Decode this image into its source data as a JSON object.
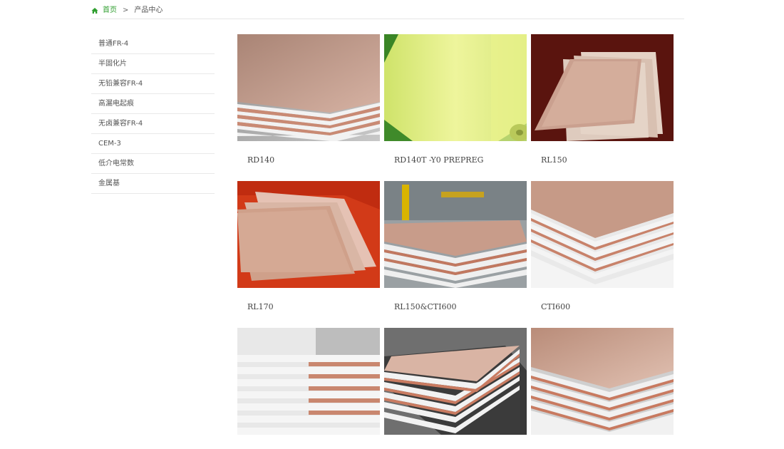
{
  "breadcrumb": {
    "home": "首页",
    "separator": ">",
    "current": "产品中心"
  },
  "sidebar": {
    "items": [
      {
        "label": "普通FR-4"
      },
      {
        "label": "半固化片"
      },
      {
        "label": "无铅兼容FR-4"
      },
      {
        "label": "高漏电起痕"
      },
      {
        "label": "无卤兼容FR-4"
      },
      {
        "label": "CEM-3"
      },
      {
        "label": "低介电常数"
      },
      {
        "label": "金属基"
      }
    ]
  },
  "products": [
    {
      "name": "RD140"
    },
    {
      "name": "RD140T -Y0 PREPREG"
    },
    {
      "name": "RL150"
    },
    {
      "name": "RL170"
    },
    {
      "name": "RL150&CTI600"
    },
    {
      "name": "CTI600"
    },
    {
      "name": ""
    },
    {
      "name": ""
    },
    {
      "name": ""
    }
  ],
  "colors": {
    "accent": "#2f9e2f",
    "copper": "#c59a88"
  }
}
